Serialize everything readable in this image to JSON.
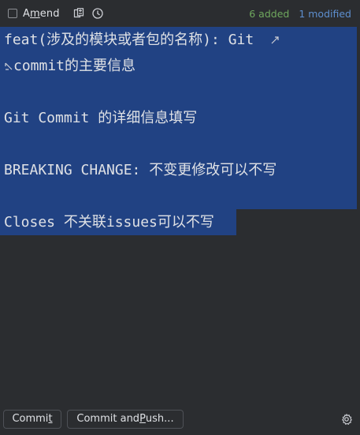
{
  "toolbar": {
    "amend_label": {
      "pre": "A",
      "mnemonic": "m",
      "post": "end"
    },
    "amend_checked": false,
    "added_text": "6 added",
    "modified_text": "1 modified",
    "colors": {
      "added": "#6fa85e",
      "modified": "#5e8fcf"
    },
    "icons": [
      "diff-icon",
      "history-icon"
    ]
  },
  "editor": {
    "lines": [
      "feat(涉及的模块或者包的名称): Git",
      "commit的主要信息",
      "",
      "Git Commit 的详细信息填写",
      "",
      "BREAKING CHANGE: 不变更修改可以不写",
      "",
      "Closes 不关联issues可以不写"
    ],
    "selection_color": "#214283"
  },
  "bottom": {
    "commit_button": {
      "pre": "Commi",
      "mnemonic": "t",
      "post": ""
    },
    "push_button": {
      "pre": "Commit and ",
      "mnemonic": "P",
      "post": "ush..."
    },
    "icons": [
      "gear-icon"
    ]
  }
}
